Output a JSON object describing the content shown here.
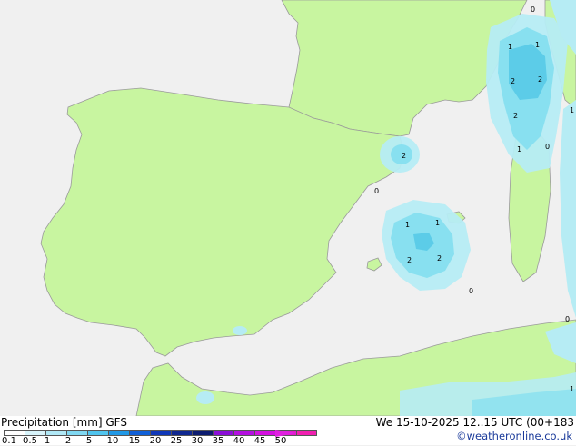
{
  "map": {
    "contour_labels": [
      "0",
      "1",
      "1",
      "2",
      "2",
      "2",
      "1",
      "0",
      "1",
      "2",
      "0",
      "1",
      "1",
      "2",
      "2",
      "0",
      "0",
      "1",
      "0",
      "0"
    ],
    "colors": {
      "land": "#c8f5a0",
      "sea": "#f0f0f0",
      "precip_light": "#b6ecf4",
      "precip_mid": "#88e0f0",
      "precip_high": "#5ccce8"
    }
  },
  "footer": {
    "title": "Precipitation [mm]  GFS",
    "valid_time": "We 15-10-2025 12..15 UTC (00+183",
    "credit": "©weatheronline.co.uk",
    "scale_colors": [
      "#ffffff",
      "#d8f4fb",
      "#b0e8f6",
      "#80d8f2",
      "#50c4ee",
      "#2098e6",
      "#1060d8",
      "#1038b8",
      "#102890",
      "#0c1c70",
      "#8c10d8",
      "#b410e0",
      "#d410e0",
      "#e418c8",
      "#f020b0"
    ],
    "scale_ticks": [
      "0.1",
      "0.5",
      "1",
      "2",
      "5",
      "10",
      "15",
      "20",
      "25",
      "30",
      "35",
      "40",
      "45",
      "50"
    ]
  }
}
